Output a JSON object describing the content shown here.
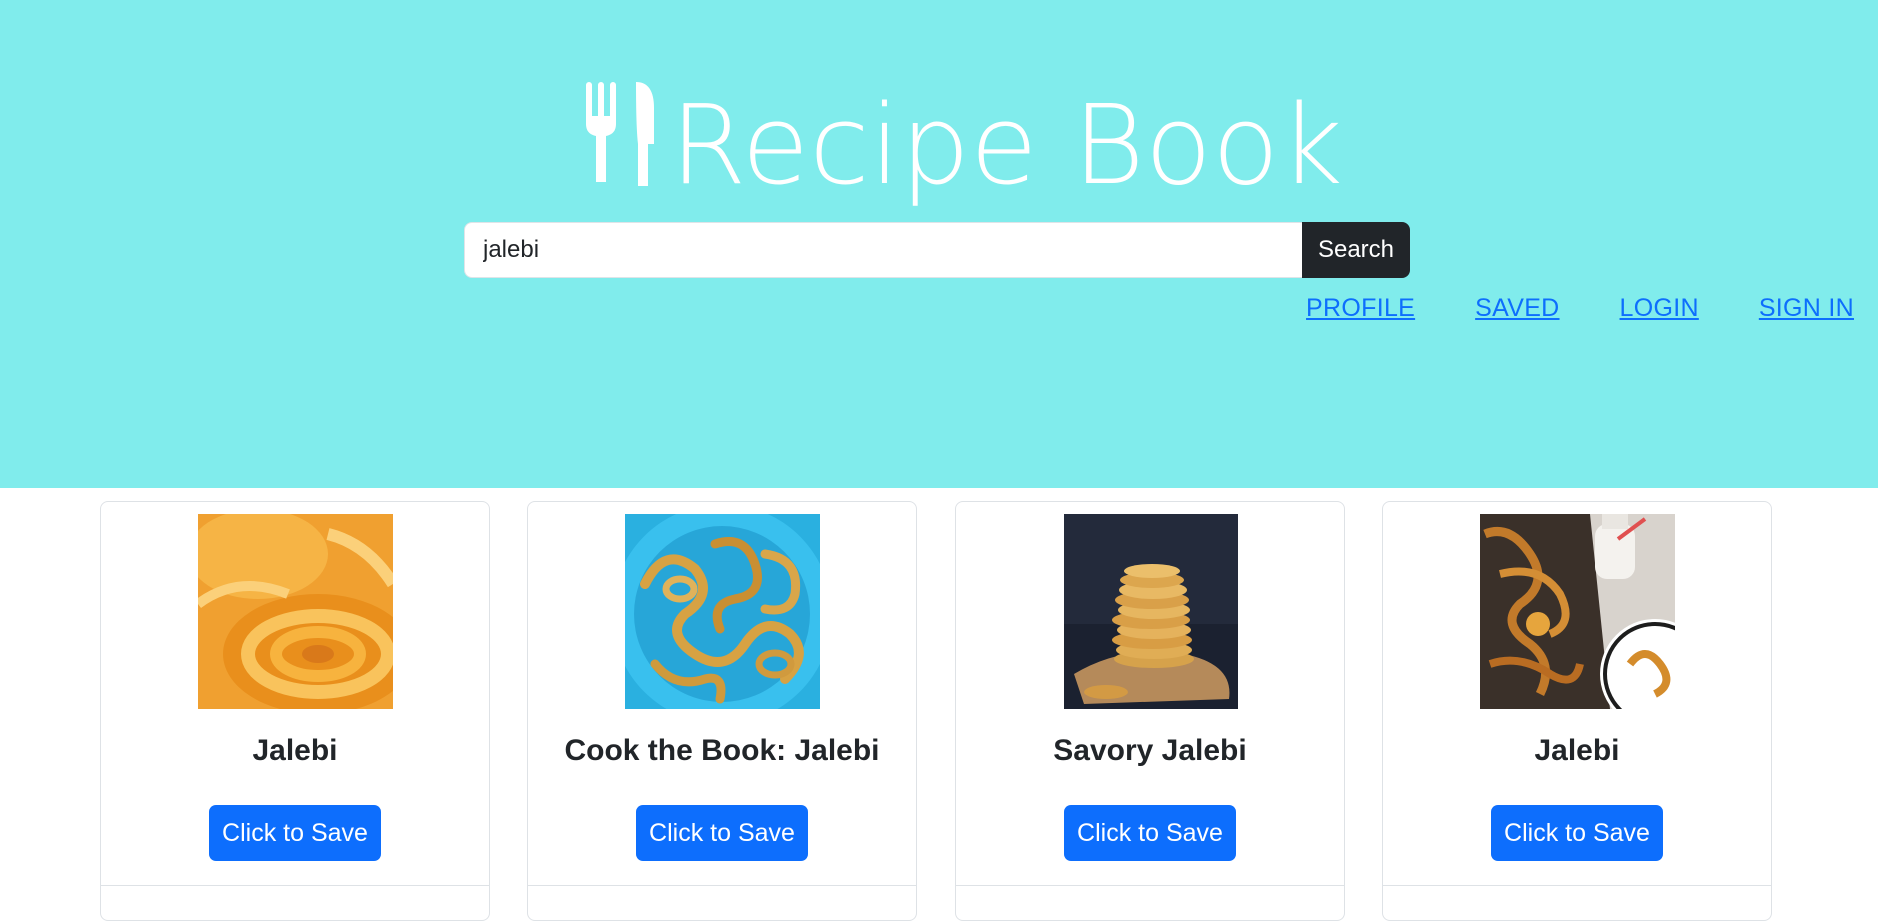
{
  "header": {
    "brand_title": "Recipe Book",
    "brand_icon": "fork-knife-icon",
    "background_color": "#80ecec"
  },
  "search": {
    "value": "jalebi",
    "button_label": "Search"
  },
  "nav": {
    "items": [
      {
        "label": "PROFILE"
      },
      {
        "label": "SAVED"
      },
      {
        "label": "LOGIN"
      },
      {
        "label": "SIGN IN"
      }
    ],
    "link_color": "#0d6efd"
  },
  "recipes": [
    {
      "title": "Jalebi",
      "save_label": "Click to Save",
      "image": "jalebi-photo"
    },
    {
      "title": "Cook the Book: Jalebi",
      "save_label": "Click to Save",
      "image": "jalebi-on-blue-plate-photo"
    },
    {
      "title": "Savory Jalebi",
      "save_label": "Click to Save",
      "image": "savory-jalebi-stack-photo"
    },
    {
      "title": "Jalebi",
      "save_label": "Click to Save",
      "image": "jalebi-tray-with-milk-photo"
    }
  ],
  "colors": {
    "primary_button": "#0d6efd",
    "search_button": "#212529"
  }
}
